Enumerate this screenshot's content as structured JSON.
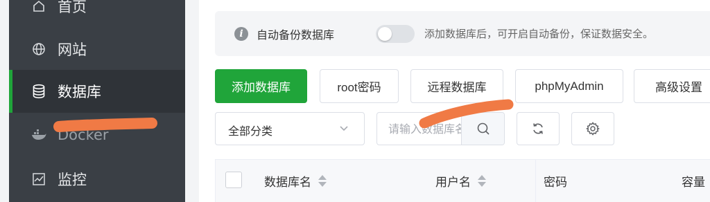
{
  "sidebar": {
    "items": [
      {
        "label": "首页",
        "icon": "home-icon"
      },
      {
        "label": "网站",
        "icon": "globe-icon"
      },
      {
        "label": "数据库",
        "icon": "database-icon",
        "active": true
      },
      {
        "label": "Docker",
        "icon": "docker-icon"
      },
      {
        "label": "监控",
        "icon": "monitor-icon"
      }
    ]
  },
  "tip": {
    "label": "自动备份数据库",
    "toggle_on": false,
    "hint": "添加数据库后，可开启自动备份，保证数据安全。"
  },
  "toolbar": {
    "add": "添加数据库",
    "root_pwd": "root密码",
    "remote": "远程数据库",
    "phpmyadmin": "phpMyAdmin",
    "advanced": "高级设置"
  },
  "filter": {
    "category": "全部分类",
    "search_placeholder": "请输入数据库名称/备注"
  },
  "table": {
    "columns": [
      "数据库名",
      "用户名",
      "密码",
      "容量"
    ]
  },
  "colors": {
    "accent": "#20a53a",
    "sidebar_bg": "#3a3f45",
    "redaction": "#f07a45"
  }
}
